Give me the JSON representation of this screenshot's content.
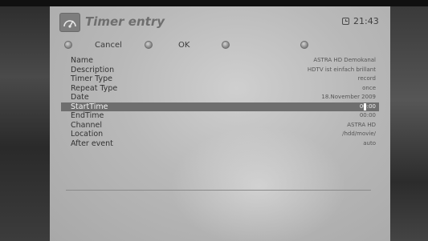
{
  "header": {
    "title": "Timer entry",
    "clock": "21:43"
  },
  "buttons": {
    "cancel": "Cancel",
    "ok": "OK"
  },
  "fields": [
    {
      "label": "Name",
      "value": "ASTRA HD Demokanal"
    },
    {
      "label": "Description",
      "value": "HDTV ist einfach brillant"
    },
    {
      "label": "Timer Type",
      "value": "record"
    },
    {
      "label": "Repeat Type",
      "value": "once"
    },
    {
      "label": "Date",
      "value": "18.November 2009"
    },
    {
      "label": "StartTime",
      "value": "00:00"
    },
    {
      "label": "EndTime",
      "value": "00:00"
    },
    {
      "label": "Channel",
      "value": "ASTRA HD"
    },
    {
      "label": "Location",
      "value": "/hdd/movie/"
    },
    {
      "label": "After event",
      "value": "auto"
    }
  ],
  "selected_field": "StartTime",
  "icons": {
    "header": "timer-gauge-icon",
    "clock": "clock-icon"
  }
}
